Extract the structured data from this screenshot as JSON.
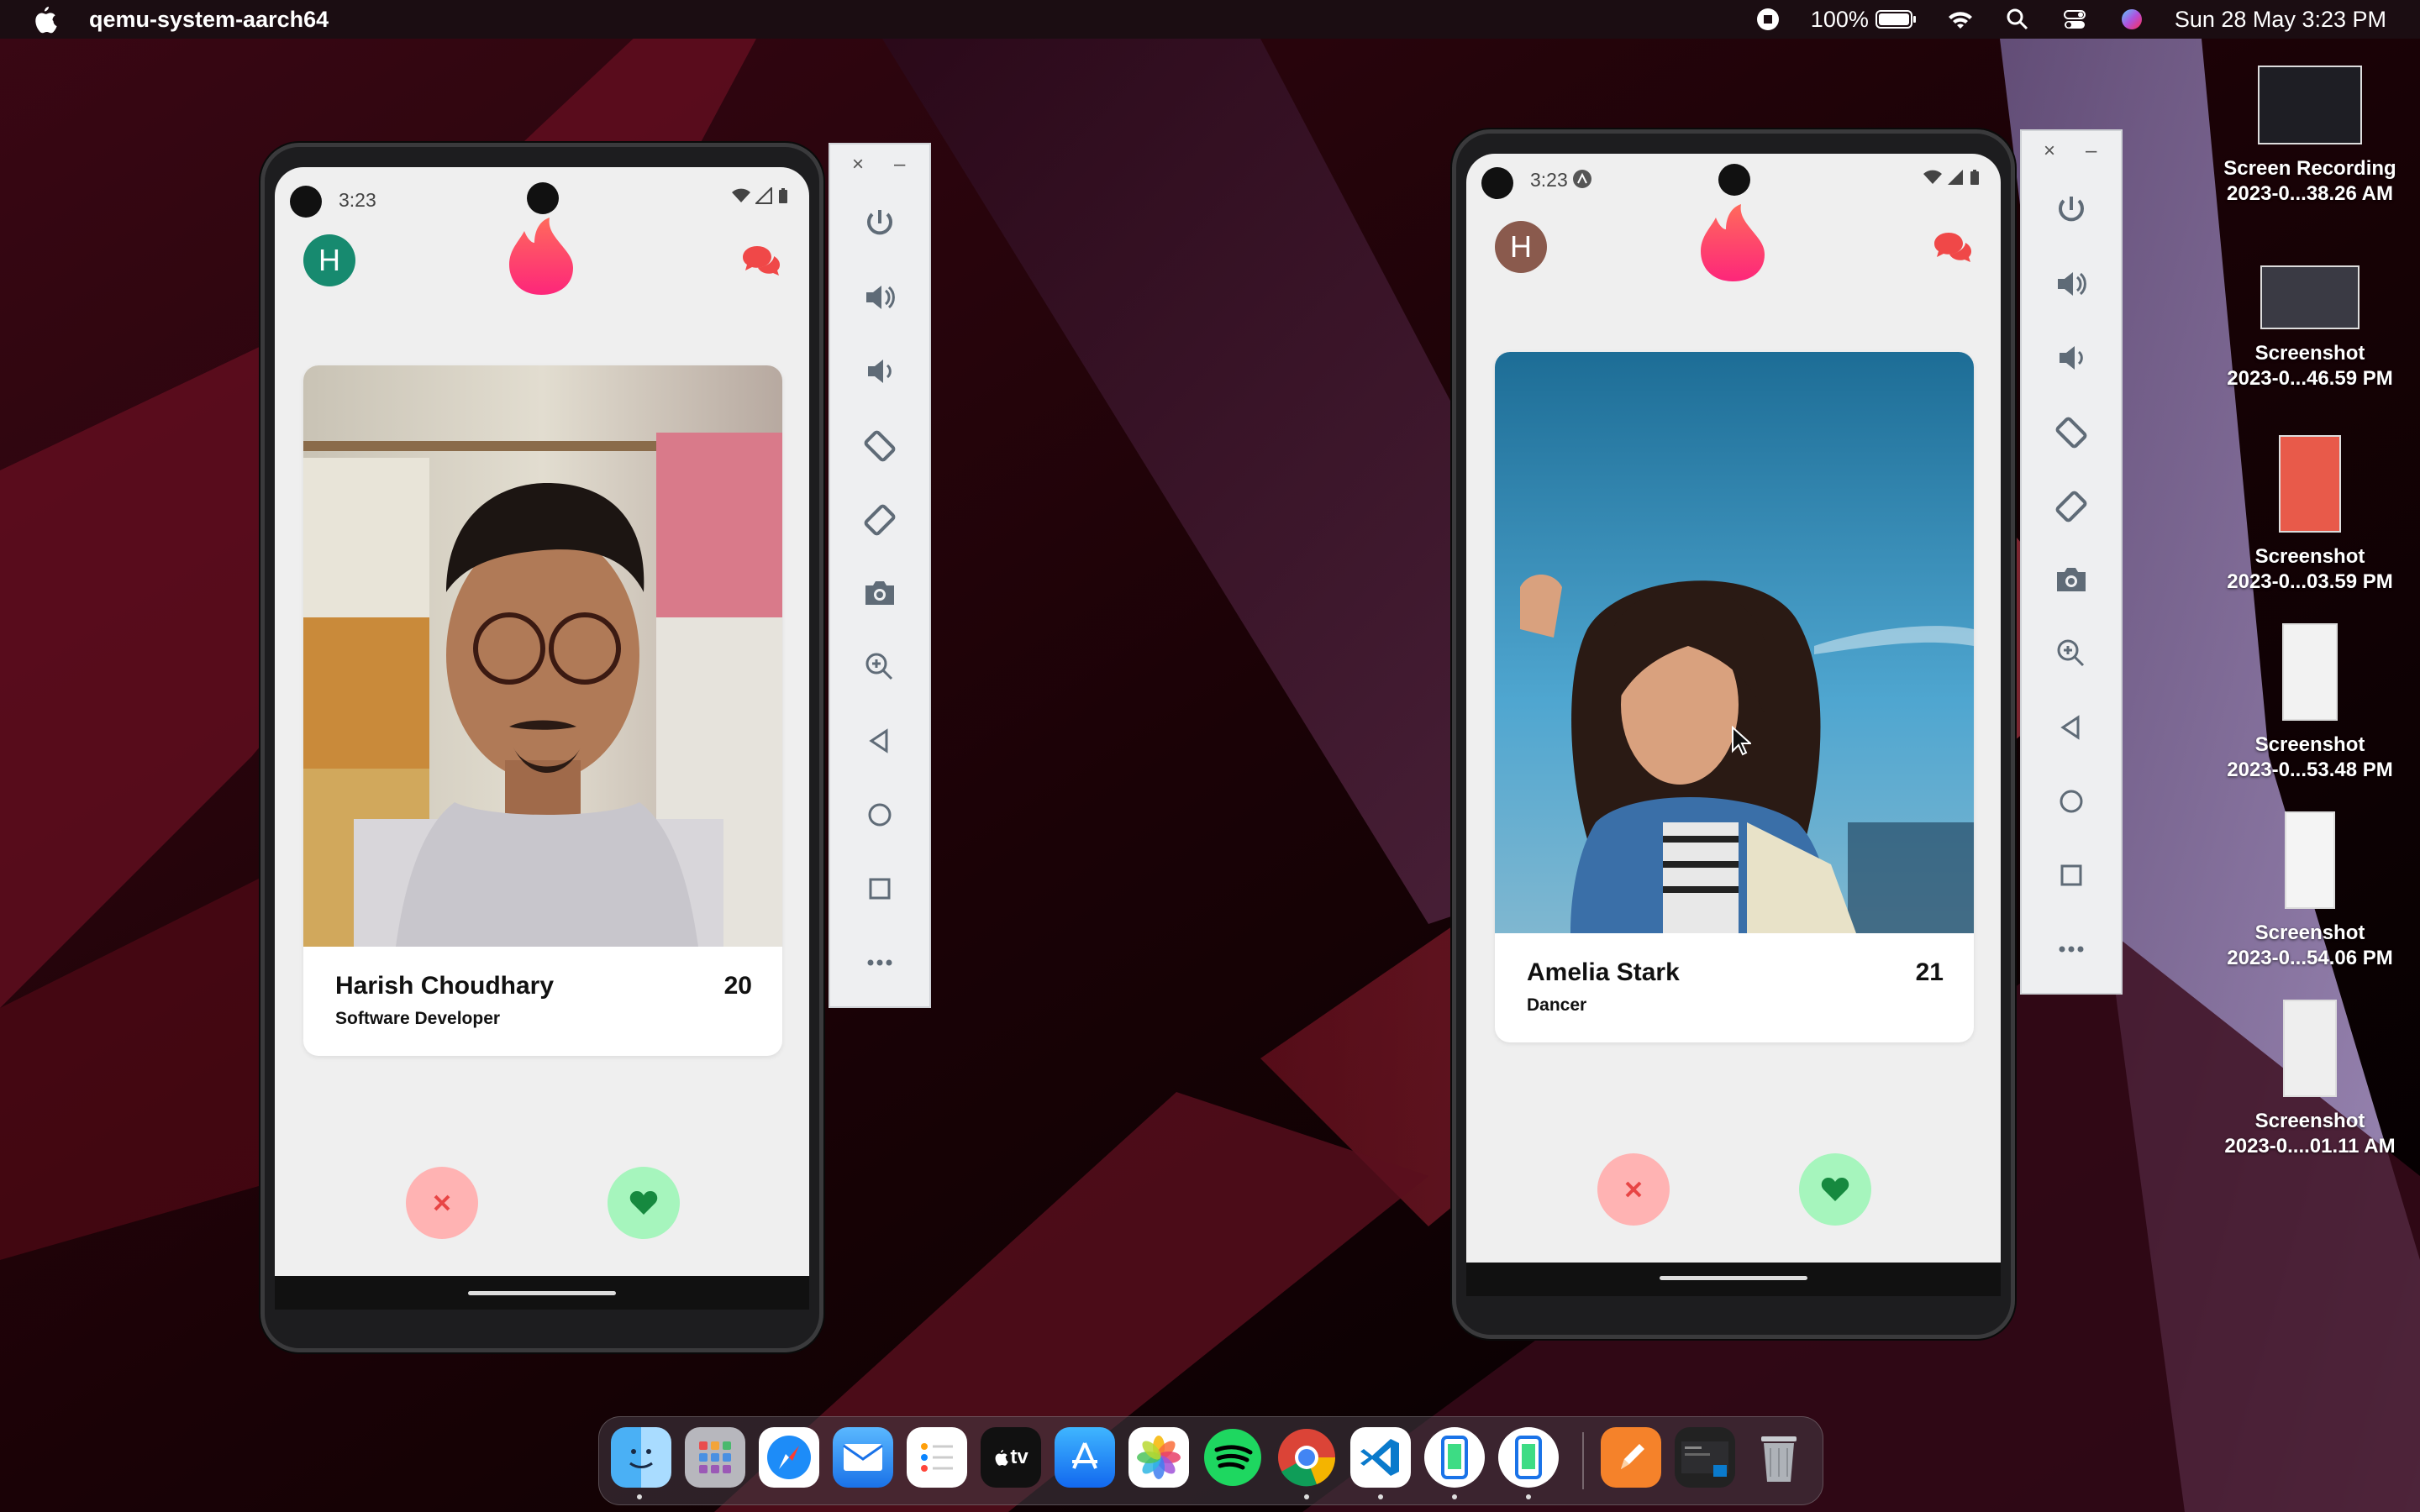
{
  "menubar": {
    "app_name": "qemu-system-aarch64",
    "battery": "100%",
    "datetime": "Sun 28 May  3:23 PM"
  },
  "phone1": {
    "time": "3:23",
    "avatar_letter": "H",
    "card": {
      "name": "Harish Choudhary",
      "age": "20",
      "job": "Software Developer"
    }
  },
  "phone2": {
    "time": "3:23",
    "avatar_letter": "H",
    "card": {
      "name": "Amelia Stark",
      "age": "21",
      "job": "Dancer"
    }
  },
  "panel": {
    "close": "×",
    "minimize": "–"
  },
  "desktop_items": [
    {
      "line1": "Screen Recording",
      "line2": "2023-0...38.26 AM"
    },
    {
      "line1": "Screenshot",
      "line2": "2023-0...46.59 PM"
    },
    {
      "line1": "Screenshot",
      "line2": "2023-0...03.59 PM"
    },
    {
      "line1": "Screenshot",
      "line2": "2023-0...53.48 PM"
    },
    {
      "line1": "Screenshot",
      "line2": "2023-0...54.06 PM"
    },
    {
      "line1": "Screenshot",
      "line2": "2023-0....01.11 AM"
    }
  ],
  "dock": {
    "tv_label": "tv"
  },
  "colors": {
    "tinder_gradient_top": "#fd5068",
    "tinder_gradient_bottom": "#ff7854",
    "reject_bg": "#ffb3b3",
    "like_bg": "#a6f5bd",
    "avatar1": "#178a6f",
    "avatar2": "#8a5a4d"
  }
}
